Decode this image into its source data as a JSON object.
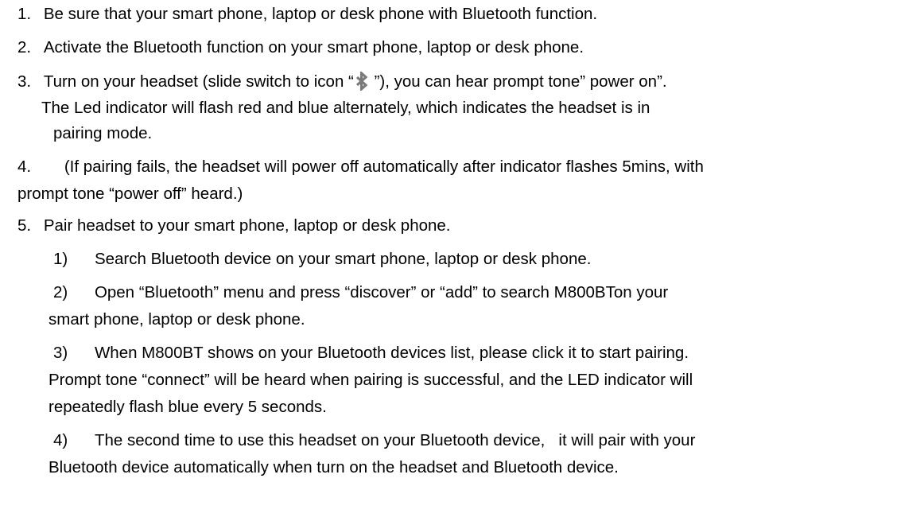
{
  "items": {
    "step1": {
      "num": "1.",
      "text": "Be sure that your smart phone, laptop or desk phone with Bluetooth function."
    },
    "step2": {
      "num": "2.",
      "text": "Activate the Bluetooth function on your smart phone, laptop or desk phone."
    },
    "step3": {
      "num": "3.",
      "text_before_icon": "Turn on your headset (slide switch to icon “",
      "text_after_icon": " ”), you can hear prompt tone” power on”.",
      "line2": "The Led indicator will flash red and blue alternately, which indicates the headset is in",
      "line3": "pairing mode."
    },
    "step4": {
      "num": "4.",
      "line1": "(If pairing fails, the headset will power off automatically after indicator flashes 5mins, with",
      "line2": "prompt tone “power off” heard.)"
    },
    "step5": {
      "num": "5.",
      "text": "Pair headset to your smart phone, laptop or desk phone.",
      "sub1": {
        "num": "1)",
        "text": "Search Bluetooth device on your smart phone, laptop or desk phone."
      },
      "sub2": {
        "num": "2)",
        "line1": "Open “Bluetooth” menu and press “discover” or “add” to search M800BTon your",
        "line2": "smart phone, laptop or desk phone."
      },
      "sub3": {
        "num": "3)",
        "line1": "When M800BT shows on your Bluetooth devices list, please click it to start pairing.",
        "line2": "Prompt tone “connect” will be heard when pairing is successful, and the LED indicator will",
        "line3": "repeatedly flash blue every 5 seconds."
      },
      "sub4": {
        "num": "4)",
        "line1": "The second time to use this headset on your Bluetooth device,   it will pair with your",
        "line2": "Bluetooth device automatically when turn on the headset and Bluetooth device."
      }
    }
  },
  "icons": {
    "bluetooth": "bluetooth-icon"
  }
}
